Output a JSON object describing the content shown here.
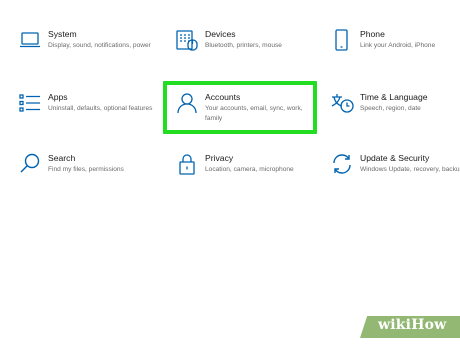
{
  "settings": {
    "tiles": [
      {
        "name": "system",
        "title": "System",
        "description": "Display, sound, notifications, power",
        "icon": "laptop-icon"
      },
      {
        "name": "devices",
        "title": "Devices",
        "description": "Bluetooth, printers, mouse",
        "icon": "keyboard-icon"
      },
      {
        "name": "phone",
        "title": "Phone",
        "description": "Link your Android, iPhone",
        "icon": "phone-icon"
      },
      {
        "name": "apps",
        "title": "Apps",
        "description": "Uninstall, defaults, optional features",
        "icon": "apps-list-icon"
      },
      {
        "name": "accounts",
        "title": "Accounts",
        "description": "Your accounts, email, sync, work, family",
        "icon": "person-icon"
      },
      {
        "name": "time-language",
        "title": "Time & Language",
        "description": "Speech, region, date",
        "icon": "time-language-icon"
      },
      {
        "name": "search",
        "title": "Search",
        "description": "Find my files, permissions",
        "icon": "search-icon"
      },
      {
        "name": "privacy",
        "title": "Privacy",
        "description": "Location, camera, microphone",
        "icon": "lock-icon"
      },
      {
        "name": "update-security",
        "title": "Update & Security",
        "description": "Windows Update, recovery, backup",
        "icon": "sync-arrows-icon"
      }
    ]
  },
  "highlight": {
    "target": "accounts",
    "color": "#22dd22"
  },
  "watermark": {
    "text": "wikiHow",
    "color": "#93b874"
  },
  "colors": {
    "accent": "#0063b1",
    "title": "#1a1a1a",
    "description": "#6b6b6b"
  }
}
